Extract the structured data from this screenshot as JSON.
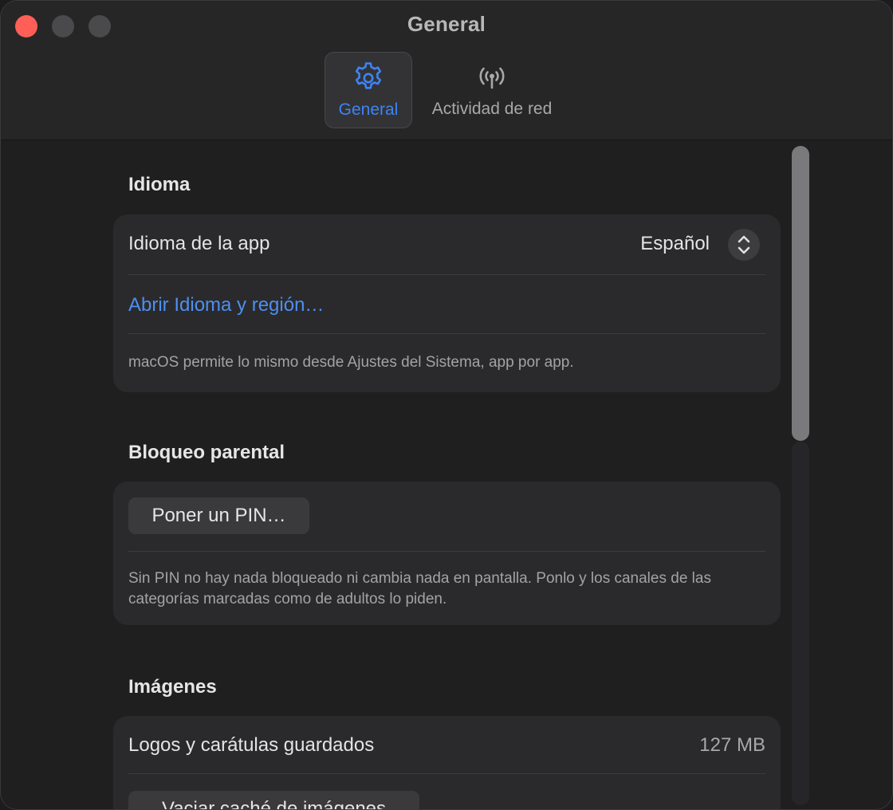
{
  "window": {
    "title": "General"
  },
  "toolbar": {
    "tabs": [
      {
        "label": "General",
        "icon": "gear-icon",
        "selected": true
      },
      {
        "label": "Actividad de red",
        "icon": "antenna-icon",
        "selected": false
      }
    ]
  },
  "sections": {
    "language": {
      "title": "Idioma",
      "app_language_label": "Idioma de la app",
      "app_language_value": "Español",
      "open_link": "Abrir Idioma y región…",
      "footnote": "macOS permite lo mismo desde Ajustes del Sistema, app por app."
    },
    "parental": {
      "title": "Bloqueo parental",
      "set_pin_button": "Poner un PIN…",
      "footnote": "Sin PIN no hay nada bloqueado ni cambia nada en pantalla. Ponlo y los canales de las categorías marcadas como de adultos lo piden."
    },
    "images": {
      "title": "Imágenes",
      "saved_label": "Logos y carátulas guardados",
      "saved_value": "127 MB",
      "clear_button": "Vaciar caché de imágenes"
    }
  },
  "colors": {
    "accent": "#3d84f5",
    "link": "#4e8ff0",
    "close": "#ff5f57",
    "background": "#1f1f1f",
    "group": "#2a2a2c"
  }
}
